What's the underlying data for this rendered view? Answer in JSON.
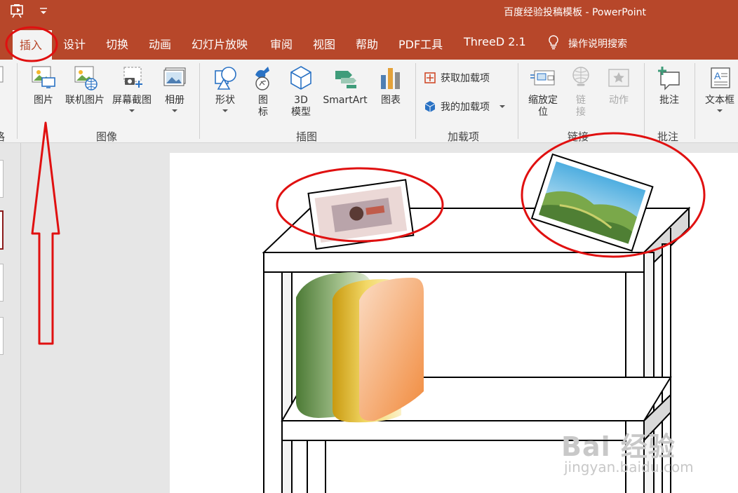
{
  "window": {
    "title": "百度经验投稿模板 - PowerPoint",
    "accent_color": "#b7472a"
  },
  "quick_access": {
    "icon": "slideshow-start-icon",
    "customize_icon": "chevron-down-icon"
  },
  "tabs": [
    {
      "label": "插入",
      "active": true
    },
    {
      "label": "设计"
    },
    {
      "label": "切换"
    },
    {
      "label": "动画"
    },
    {
      "label": "幻灯片放映"
    },
    {
      "label": "审阅"
    },
    {
      "label": "视图"
    },
    {
      "label": "帮助"
    },
    {
      "label": "PDF工具"
    },
    {
      "label": "ThreeD 2.1"
    }
  ],
  "tell_me": {
    "label": "操作说明搜索",
    "icon": "lightbulb-icon"
  },
  "ribbon": {
    "partial_left_label": "格",
    "groups": {
      "images": {
        "label": "图像",
        "buttons": [
          {
            "label": "图片",
            "icon": "picture-icon"
          },
          {
            "label": "联机图片",
            "icon": "online-picture-icon"
          },
          {
            "label": "屏幕截图",
            "icon": "screenshot-icon"
          },
          {
            "label": "相册",
            "icon": "photo-album-icon"
          }
        ]
      },
      "illustrations": {
        "label": "插图",
        "buttons": [
          {
            "label": "形状",
            "icon": "shapes-icon"
          },
          {
            "label": "图标",
            "icon": "icons-icon"
          },
          {
            "label": "3D模型",
            "icon": "3d-model-icon"
          },
          {
            "label": "SmartArt",
            "icon": "smartart-icon"
          },
          {
            "label": "图表",
            "icon": "chart-icon"
          }
        ]
      },
      "addins": {
        "label": "加载项",
        "buttons": [
          {
            "label": "获取加载项",
            "icon": "store-icon"
          },
          {
            "label": "我的加载项",
            "icon": "my-addins-icon"
          }
        ]
      },
      "links": {
        "label": "链接",
        "buttons": [
          {
            "label": "缩放定位",
            "icon": "zoom-icon"
          },
          {
            "label": "链接",
            "icon": "link-icon",
            "disabled": true
          },
          {
            "label": "动作",
            "icon": "action-icon",
            "disabled": true
          }
        ]
      },
      "comments": {
        "label": "批注",
        "buttons": [
          {
            "label": "批注",
            "icon": "comment-icon"
          }
        ]
      },
      "text": {
        "buttons": [
          {
            "label": "文本框",
            "icon": "textbox-icon"
          }
        ]
      }
    }
  },
  "watermark": {
    "brand": "Bai 经验",
    "url": "jingyan.baidu.com"
  },
  "colors": {
    "annotation_red": "#e01010",
    "ribbon_bg": "#f3f3f3",
    "slide_bg": "#ffffff"
  }
}
